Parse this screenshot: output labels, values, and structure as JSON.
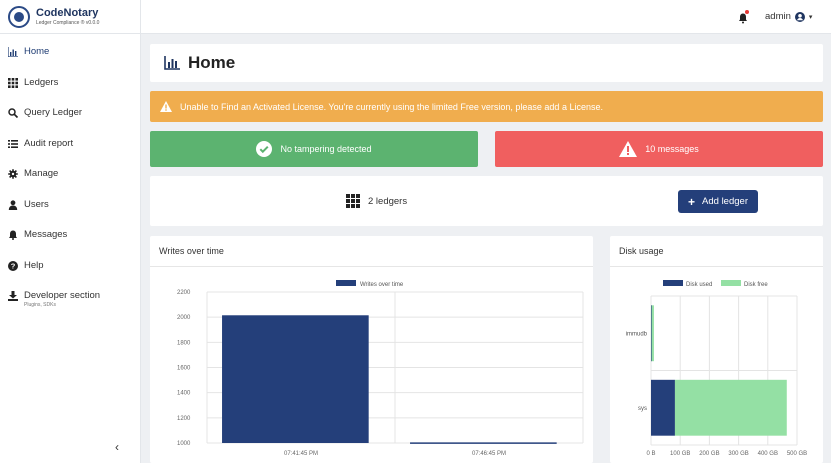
{
  "brand": {
    "name": "CodeNotary",
    "subtitle": "Ledger Compliance ® v0.0.0"
  },
  "sidebar": {
    "items": [
      {
        "label": "Home",
        "icon": "bar-chart-icon",
        "active": true
      },
      {
        "label": "Ledgers",
        "icon": "grid-icon"
      },
      {
        "label": "Query Ledger",
        "icon": "search-icon"
      },
      {
        "label": "Audit report",
        "icon": "list-icon"
      },
      {
        "label": "Manage",
        "icon": "gear-icon"
      },
      {
        "label": "Users",
        "icon": "user-icon"
      },
      {
        "label": "Messages",
        "icon": "bell-icon"
      },
      {
        "label": "Help",
        "icon": "help-icon"
      },
      {
        "label": "Developer section",
        "icon": "download-icon",
        "sub": "Plugins, SDKs"
      }
    ],
    "collapse_glyph": "‹"
  },
  "topbar": {
    "user": "admin",
    "caret": "▾"
  },
  "page": {
    "title": "Home"
  },
  "alerts": {
    "license": "Unable to Find an Activated License. You're currently using the limited Free version, please add a License.",
    "tamper": "No tampering detected",
    "messages": "10 messages"
  },
  "ledgers": {
    "count_label": "2 ledgers",
    "add_label": "Add ledger"
  },
  "colors": {
    "primary": "#243f7a",
    "success": "#5cb370",
    "danger": "#f05f5f",
    "warning": "#f0ad4e",
    "disk_free": "#94e0a4"
  },
  "writes_chart": {
    "title": "Writes over time",
    "chart_data": {
      "type": "bar",
      "legend": "Writes over time",
      "categories": [
        "07:41:45 PM",
        "07:46:45 PM"
      ],
      "values": [
        2015,
        1005
      ],
      "ylim": [
        1000,
        2200
      ],
      "yticks": [
        "1000",
        "1200",
        "1400",
        "1600",
        "1800",
        "2000",
        "2200"
      ],
      "grid": true
    }
  },
  "disk_chart": {
    "title": "Disk usage",
    "chart_data": {
      "type": "bar",
      "orientation": "horizontal",
      "stacked": true,
      "categories": [
        "immudb",
        "sys"
      ],
      "series": [
        {
          "name": "Disk used",
          "values": [
            2,
            82
          ]
        },
        {
          "name": "Disk free",
          "values": [
            8,
            383
          ]
        }
      ],
      "xticks": [
        "0 B",
        "100 GB",
        "200 GB",
        "300 GB",
        "400 GB",
        "500 GB"
      ],
      "xlim": [
        0,
        500
      ],
      "grid": true
    }
  }
}
